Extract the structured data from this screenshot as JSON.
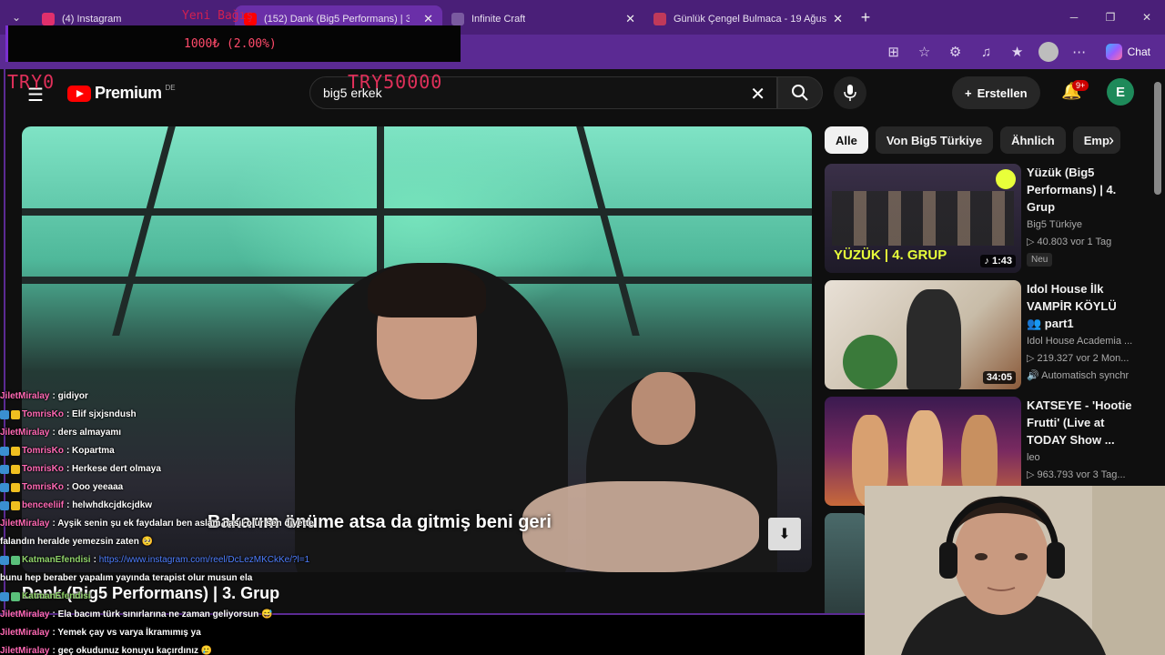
{
  "browser": {
    "tabs": [
      {
        "label": "(4) Instagram",
        "favicon_color": "#e1306c",
        "active": false
      },
      {
        "label": "(152) Dank (Big5 Performans) | 3. G",
        "favicon_color": "#ff0000",
        "active": true
      },
      {
        "label": "Infinite Craft",
        "favicon_color": "#7a5aa0",
        "active": false
      },
      {
        "label": "Günlük Çengel Bulmaca - 19 Ağus",
        "favicon_color": "#c0395a",
        "active": false
      }
    ],
    "chat_label": "Chat"
  },
  "overlay": {
    "donation_amount": "1000₺ (2.00%)",
    "top_small": "Yeni Bağış",
    "left_label": "TRY0",
    "goal_label": "TRY50000"
  },
  "youtube": {
    "brand": "Premium",
    "region": "DE",
    "search_value": "big5 erkek",
    "create_label": "Erstellen",
    "notification_count": "9+",
    "account_initial": "E",
    "accent": "#ff0000"
  },
  "player": {
    "subtitle": "Bakarım önüme atsa da gitmiş beni geri",
    "video_title": "Dank (Big5 Performans) | 3. Grup"
  },
  "chips": [
    "Alle",
    "Von Big5 Türkiye",
    "Ähnlich",
    "Emp"
  ],
  "recommendations": [
    {
      "title": "Yüzük (Big5 Performans) | 4. Grup",
      "channel": "Big5 Türkiye",
      "views": "▷ 40.803  vor 1 Tag",
      "tag": "Neu",
      "duration": "♪ 1:43",
      "thumb_text": "YÜZÜK | 4. GRUP"
    },
    {
      "title": "Idol House İlk VAMPİR KÖYLÜ 👥 part1",
      "channel": "Idol House Academia ...",
      "views": "▷ 219.327  vor 2 Mon...",
      "tag": "🔊 Automatisch synchr",
      "duration": "34:05",
      "thumb_text": ""
    },
    {
      "title": "KATSEYE - 'Hootie Frutti' (Live at TODAY Show ...",
      "channel": "leo",
      "views": "▷ 963.793  vor 3 Tag...",
      "tag": "",
      "duration": "",
      "thumb_text": ""
    }
  ],
  "chat": [
    {
      "user": "JiletMiralay",
      "color": "#ff69b4",
      "badges": false,
      "text": ": gidiyor"
    },
    {
      "user": "TomrisKo",
      "color": "#ff69b4",
      "badges": true,
      "text": ": Elif sjxjsndush"
    },
    {
      "user": "JiletMiralay",
      "color": "#ff69b4",
      "badges": false,
      "text": ": ders almayamı"
    },
    {
      "user": "TomrisKo",
      "color": "#ff69b4",
      "badges": true,
      "text": ": Kopartma"
    },
    {
      "user": "TomrisKo",
      "color": "#ff69b4",
      "badges": true,
      "text": ": Herkese dert olmaya"
    },
    {
      "user": "TomrisKo",
      "color": "#ff69b4",
      "badges": true,
      "text": ": Ooo yeeaaa"
    },
    {
      "user": "benceeliif",
      "color": "#ff69b4",
      "badges": true,
      "text": ": helwhdkcjdkcjdkw"
    },
    {
      "user": "JiletMiralay",
      "color": "#ff69b4",
      "badges": false,
      "text": ": Ayşik senin şu ek faydaları ben aslam nasıl olur sen diyette"
    },
    {
      "user": "",
      "color": "#ffffff",
      "badges": false,
      "text": "falandın heralde yemezsin zaten 🥺"
    },
    {
      "user": "KatmanEfendisi",
      "color": "#8fd16a",
      "badges": true,
      "text": ":",
      "link": "https://www.instagram.com/reel/DcLezMKCkKe/?l=1"
    },
    {
      "user": "",
      "color": "#ffffff",
      "badges": false,
      "text": "bunu hep beraber yapalım yayında terapist olur musun ela"
    },
    {
      "user": "KatmanEfendisi",
      "color": "#8fd16a",
      "badges": true,
      "text": ""
    },
    {
      "user": "JiletMiralay",
      "color": "#ff69b4",
      "badges": false,
      "text": ": Ela bacım türk sınırlarına ne zaman geliyorsun 😅"
    },
    {
      "user": "JiletMiralay",
      "color": "#ff69b4",
      "badges": false,
      "text": ": Yemek çay vs varya İkramımış ya"
    },
    {
      "user": "JiletMiralay",
      "color": "#ff69b4",
      "badges": false,
      "text": ": geç okudunuz konuyu kaçırdınız 🥲"
    }
  ]
}
